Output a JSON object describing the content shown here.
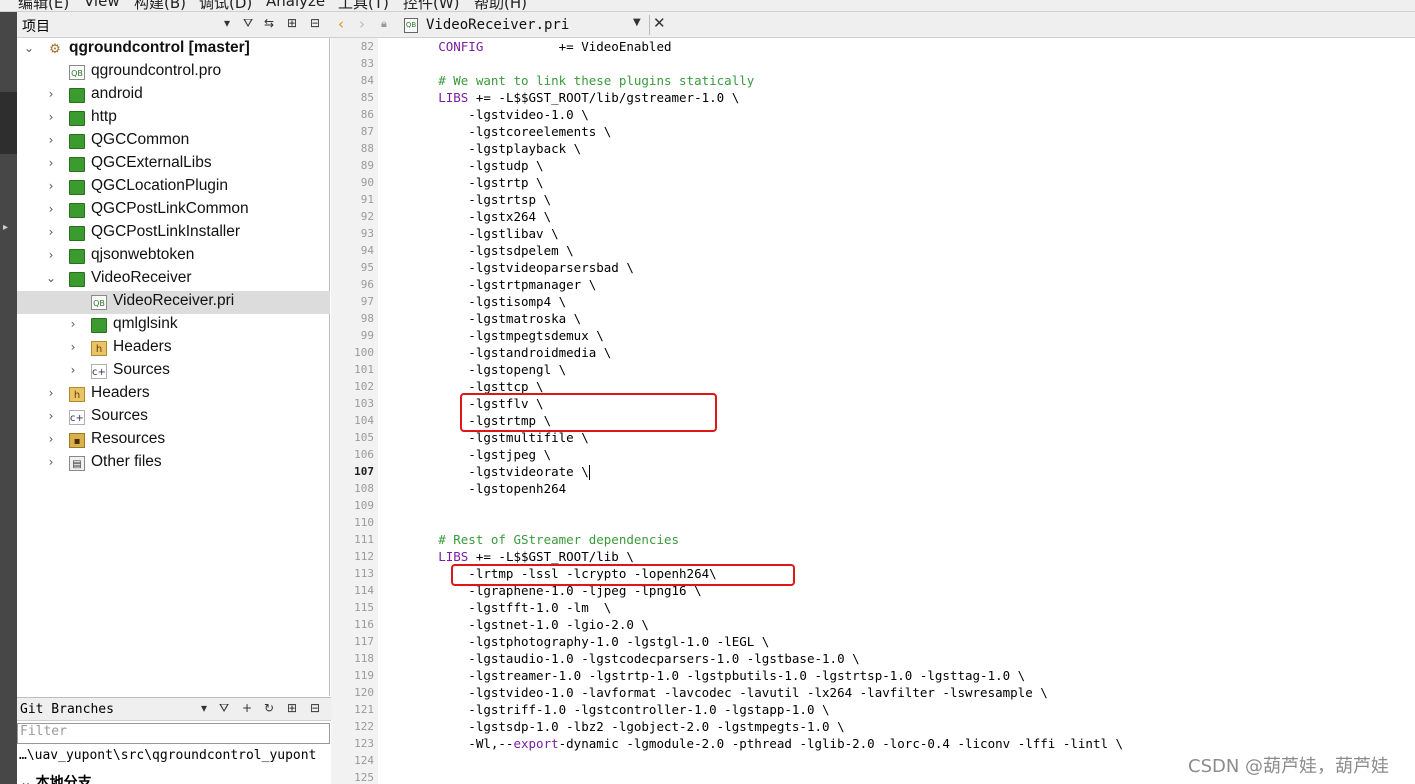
{
  "menu": {
    "items": [
      "编辑(E)",
      "View",
      "构建(B)",
      "调试(D)",
      "Analyze",
      "工具(T)",
      "控件(W)",
      "帮助(H)"
    ]
  },
  "project_pane": {
    "title": "项目",
    "tree": [
      {
        "label": "qgroundcontrol [master]",
        "level": 0,
        "expanded": true,
        "icon": "project-icon",
        "bold": true
      },
      {
        "label": "qgroundcontrol.pro",
        "level": 1,
        "icon": "pro-file-icon"
      },
      {
        "label": "android",
        "level": 1,
        "expanded": false,
        "icon": "folder-icon"
      },
      {
        "label": "http",
        "level": 1,
        "expanded": false,
        "icon": "folder-icon"
      },
      {
        "label": "QGCCommon",
        "level": 1,
        "expanded": false,
        "icon": "folder-icon"
      },
      {
        "label": "QGCExternalLibs",
        "level": 1,
        "expanded": false,
        "icon": "folder-icon"
      },
      {
        "label": "QGCLocationPlugin",
        "level": 1,
        "expanded": false,
        "icon": "folder-icon"
      },
      {
        "label": "QGCPostLinkCommon",
        "level": 1,
        "expanded": false,
        "icon": "folder-icon"
      },
      {
        "label": "QGCPostLinkInstaller",
        "level": 1,
        "expanded": false,
        "icon": "folder-icon"
      },
      {
        "label": "qjsonwebtoken",
        "level": 1,
        "expanded": false,
        "icon": "folder-icon"
      },
      {
        "label": "VideoReceiver",
        "level": 1,
        "expanded": true,
        "icon": "folder-icon"
      },
      {
        "label": "VideoReceiver.pri",
        "level": 2,
        "icon": "pri-file-icon",
        "selected": true
      },
      {
        "label": "qmlglsink",
        "level": 2,
        "expanded": false,
        "icon": "folder-icon"
      },
      {
        "label": "Headers",
        "level": 2,
        "expanded": false,
        "icon": "headers-icon"
      },
      {
        "label": "Sources",
        "level": 2,
        "expanded": false,
        "icon": "sources-icon"
      },
      {
        "label": "Headers",
        "level": 1,
        "expanded": false,
        "icon": "headers-icon"
      },
      {
        "label": "Sources",
        "level": 1,
        "expanded": false,
        "icon": "sources-icon"
      },
      {
        "label": "Resources",
        "level": 1,
        "expanded": false,
        "icon": "resources-icon"
      },
      {
        "label": "Other files",
        "level": 1,
        "expanded": false,
        "icon": "other-files-icon"
      }
    ]
  },
  "git_pane": {
    "title": "Git Branches",
    "filter_placeholder": "Filter",
    "path": "…\\uav_yupont\\src\\qgroundcontrol_yupont",
    "local_branches": "本地分支"
  },
  "editor": {
    "file_name": "VideoReceiver.pri",
    "current_line": 107,
    "lines": [
      {
        "n": 82,
        "segs": [
          {
            "c": "kw",
            "t": "        CONFIG"
          },
          {
            "c": "tx",
            "t": "          += VideoEnabled"
          }
        ]
      },
      {
        "n": 83,
        "segs": []
      },
      {
        "n": 84,
        "segs": [
          {
            "c": "cm",
            "t": "        # We want to link these plugins statically"
          }
        ]
      },
      {
        "n": 85,
        "segs": [
          {
            "c": "kw",
            "t": "        LIBS"
          },
          {
            "c": "tx",
            "t": " += -L$$GST_ROOT/lib/gstreamer-1.0 \\"
          }
        ]
      },
      {
        "n": 86,
        "segs": [
          {
            "c": "tx",
            "t": "            -lgstvideo-1.0 \\"
          }
        ]
      },
      {
        "n": 87,
        "segs": [
          {
            "c": "tx",
            "t": "            -lgstcoreelements \\"
          }
        ]
      },
      {
        "n": 88,
        "segs": [
          {
            "c": "tx",
            "t": "            -lgstplayback \\"
          }
        ]
      },
      {
        "n": 89,
        "segs": [
          {
            "c": "tx",
            "t": "            -lgstudp \\"
          }
        ]
      },
      {
        "n": 90,
        "segs": [
          {
            "c": "tx",
            "t": "            -lgstrtp \\"
          }
        ]
      },
      {
        "n": 91,
        "segs": [
          {
            "c": "tx",
            "t": "            -lgstrtsp \\"
          }
        ]
      },
      {
        "n": 92,
        "segs": [
          {
            "c": "tx",
            "t": "            -lgstx264 \\"
          }
        ]
      },
      {
        "n": 93,
        "segs": [
          {
            "c": "tx",
            "t": "            -lgstlibav \\"
          }
        ]
      },
      {
        "n": 94,
        "segs": [
          {
            "c": "tx",
            "t": "            -lgstsdpelem \\"
          }
        ]
      },
      {
        "n": 95,
        "segs": [
          {
            "c": "tx",
            "t": "            -lgstvideoparsersbad \\"
          }
        ]
      },
      {
        "n": 96,
        "segs": [
          {
            "c": "tx",
            "t": "            -lgstrtpmanager \\"
          }
        ]
      },
      {
        "n": 97,
        "segs": [
          {
            "c": "tx",
            "t": "            -lgstisomp4 \\"
          }
        ]
      },
      {
        "n": 98,
        "segs": [
          {
            "c": "tx",
            "t": "            -lgstmatroska \\"
          }
        ]
      },
      {
        "n": 99,
        "segs": [
          {
            "c": "tx",
            "t": "            -lgstmpegtsdemux \\"
          }
        ]
      },
      {
        "n": 100,
        "segs": [
          {
            "c": "tx",
            "t": "            -lgstandroidmedia \\"
          }
        ]
      },
      {
        "n": 101,
        "segs": [
          {
            "c": "tx",
            "t": "            -lgstopengl \\"
          }
        ]
      },
      {
        "n": 102,
        "segs": [
          {
            "c": "tx",
            "t": "            -lgsttcp \\"
          }
        ]
      },
      {
        "n": 103,
        "segs": [
          {
            "c": "tx",
            "t": "            -lgstflv \\"
          }
        ]
      },
      {
        "n": 104,
        "segs": [
          {
            "c": "tx",
            "t": "            -lgstrtmp \\"
          }
        ]
      },
      {
        "n": 105,
        "segs": [
          {
            "c": "tx",
            "t": "            -lgstmultifile \\"
          }
        ]
      },
      {
        "n": 106,
        "segs": [
          {
            "c": "tx",
            "t": "            -lgstjpeg \\"
          }
        ]
      },
      {
        "n": 107,
        "segs": [
          {
            "c": "tx",
            "t": "            -lgstvideorate \\"
          }
        ],
        "cursor": true
      },
      {
        "n": 108,
        "segs": [
          {
            "c": "tx",
            "t": "            -lgstopenh264"
          }
        ]
      },
      {
        "n": 109,
        "segs": []
      },
      {
        "n": 110,
        "segs": []
      },
      {
        "n": 111,
        "segs": [
          {
            "c": "cm",
            "t": "        # Rest of GStreamer dependencies"
          }
        ]
      },
      {
        "n": 112,
        "segs": [
          {
            "c": "kw",
            "t": "        LIBS"
          },
          {
            "c": "tx",
            "t": " += -L$$GST_ROOT/lib \\"
          }
        ]
      },
      {
        "n": 113,
        "segs": [
          {
            "c": "tx",
            "t": "            -lrtmp -lssl -lcrypto -lopenh264\\"
          }
        ]
      },
      {
        "n": 114,
        "segs": [
          {
            "c": "tx",
            "t": "            -lgraphene-1.0 -ljpeg -lpng16 \\"
          }
        ]
      },
      {
        "n": 115,
        "segs": [
          {
            "c": "tx",
            "t": "            -lgstfft-1.0 -lm  \\"
          }
        ]
      },
      {
        "n": 116,
        "segs": [
          {
            "c": "tx",
            "t": "            -lgstnet-1.0 -lgio-2.0 \\"
          }
        ]
      },
      {
        "n": 117,
        "segs": [
          {
            "c": "tx",
            "t": "            -lgstphotography-1.0 -lgstgl-1.0 -lEGL \\"
          }
        ]
      },
      {
        "n": 118,
        "segs": [
          {
            "c": "tx",
            "t": "            -lgstaudio-1.0 -lgstcodecparsers-1.0 -lgstbase-1.0 \\"
          }
        ]
      },
      {
        "n": 119,
        "segs": [
          {
            "c": "tx",
            "t": "            -lgstreamer-1.0 -lgstrtp-1.0 -lgstpbutils-1.0 -lgstrtsp-1.0 -lgsttag-1.0 \\"
          }
        ]
      },
      {
        "n": 120,
        "segs": [
          {
            "c": "tx",
            "t": "            -lgstvideo-1.0 -lavformat -lavcodec -lavutil -lx264 -lavfilter -lswresample \\"
          }
        ]
      },
      {
        "n": 121,
        "segs": [
          {
            "c": "tx",
            "t": "            -lgstriff-1.0 -lgstcontroller-1.0 -lgstapp-1.0 \\"
          }
        ]
      },
      {
        "n": 122,
        "segs": [
          {
            "c": "tx",
            "t": "            -lgstsdp-1.0 -lbz2 -lgobject-2.0 -lgstmpegts-1.0 \\"
          }
        ]
      },
      {
        "n": 123,
        "segs": [
          {
            "c": "tx",
            "t": "            -Wl,--"
          },
          {
            "c": "kw",
            "t": "export"
          },
          {
            "c": "tx",
            "t": "-dynamic -lgmodule-2.0 -pthread -lglib-2.0 -lorc-0.4 -liconv -lffi -lintl \\"
          }
        ]
      },
      {
        "n": 124,
        "segs": []
      },
      {
        "n": 125,
        "segs": []
      }
    ]
  },
  "colors": {
    "highlight_box": "#e01515",
    "keyword": "#7a1fa2",
    "comment": "#3a9b3a"
  },
  "watermark": "CSDN @葫芦娃，葫芦娃"
}
